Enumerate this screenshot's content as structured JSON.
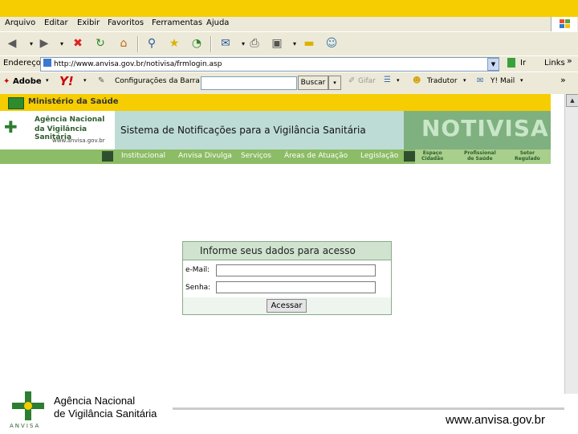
{
  "menu": {
    "items": [
      "Arquivo",
      "Editar",
      "Exibir",
      "Favoritos",
      "Ferramentas",
      "Ajuda"
    ]
  },
  "address": {
    "label": "Endereço",
    "url": "http://www.anvisa.gov.br/notivisa/frmlogin.asp",
    "go": "Ir",
    "links": "Links"
  },
  "yahoo": {
    "adobe": "Adobe",
    "yahoo": "Y!",
    "config": "Configurações da Barra",
    "search": "Buscar",
    "save": "Gifar",
    "translate": "Tradutor",
    "mail": "Y! Mail"
  },
  "site": {
    "ministry": "Ministério da Saúde",
    "agency_line1": "Agência Nacional",
    "agency_line2": "da Vigilância Sanitária",
    "agency_url": "www.anvisa.gov.br",
    "system_title": "Sistema de Notificações para a Vigilância Sanitária",
    "notivisa": "NOTIVISA",
    "nav": [
      "Institucional",
      "Anvisa Divulga",
      "Serviços",
      "Áreas de Atuação",
      "Legislação"
    ],
    "side": [
      [
        "Espaço",
        "Cidadão"
      ],
      [
        "Profissional",
        "de Saúde"
      ],
      [
        "Setor",
        "Regulado"
      ]
    ]
  },
  "login": {
    "title": "Informe seus dados para acesso",
    "email_label": "e-Mail:",
    "password_label": "Senha:",
    "submit": "Acessar"
  },
  "footer": {
    "agency_line1": "Agência Nacional",
    "agency_line2": "de Vigilância Sanitária",
    "logo_text": "ANVISA",
    "url": "www.anvisa.gov.br"
  },
  "colors": {
    "accent": "#f6cd00",
    "green": "#8cbc65",
    "dark_green": "#2f5d2f"
  }
}
